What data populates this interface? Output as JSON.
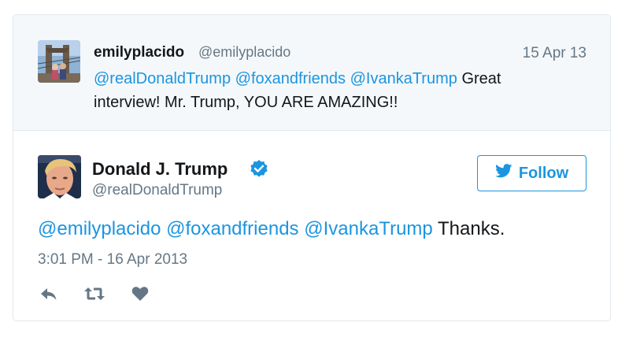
{
  "parent_tweet": {
    "name": "emilyplacido",
    "handle": "@emilyplacido",
    "date": "15 Apr 13",
    "mentions": [
      "@realDonaldTrump",
      "@foxandfriends",
      "@IvankaTrump"
    ],
    "text_rest": "Great interview! Mr. Trump, YOU ARE AMAZING!!"
  },
  "tweet": {
    "name": "Donald J. Trump",
    "handle": "@realDonaldTrump",
    "follow_label": "Follow",
    "mentions": [
      "@emilyplacido",
      "@foxandfriends",
      "@IvankaTrump"
    ],
    "text_rest": "Thanks.",
    "timestamp": "3:01 PM - 16 Apr 2013"
  },
  "icons": {
    "verified": "verified-badge-icon",
    "bird": "twitter-bird-icon",
    "reply": "reply-icon",
    "retweet": "retweet-icon",
    "like": "heart-icon"
  },
  "colors": {
    "link": "#1b95e0",
    "muted": "#657786",
    "parent_bg": "#f5f8fa",
    "border": "#e1e8ed"
  }
}
